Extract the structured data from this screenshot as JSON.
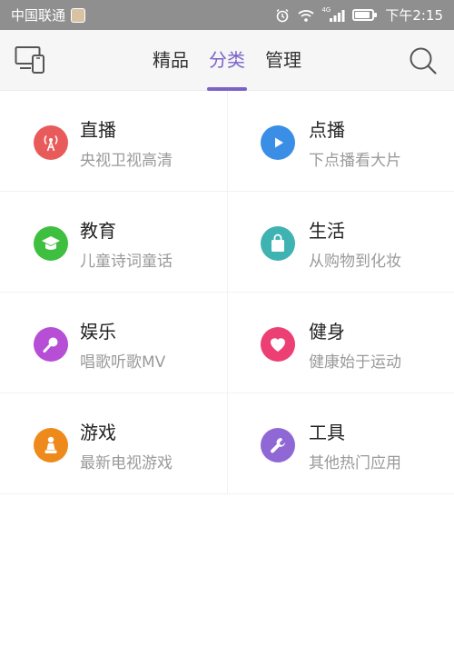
{
  "status_bar": {
    "carrier": "中国联通",
    "time": "下午2:15",
    "network_badge": "4G"
  },
  "nav": {
    "tabs": [
      {
        "label": "精品",
        "active": false
      },
      {
        "label": "分类",
        "active": true
      },
      {
        "label": "管理",
        "active": false
      }
    ],
    "accent_color": "#7b62c8"
  },
  "categories": [
    {
      "title": "直播",
      "subtitle": "央视卫视高清",
      "icon": "broadcast-tower-icon",
      "color": "#e95b5b"
    },
    {
      "title": "点播",
      "subtitle": "下点播看大片",
      "icon": "play-icon",
      "color": "#3a8ee6"
    },
    {
      "title": "教育",
      "subtitle": "儿童诗词童话",
      "icon": "graduation-cap-icon",
      "color": "#3fbf3f"
    },
    {
      "title": "生活",
      "subtitle": "从购物到化妆",
      "icon": "shopping-bag-icon",
      "color": "#3fb2b2"
    },
    {
      "title": "娱乐",
      "subtitle": "唱歌听歌MV",
      "icon": "microphone-icon",
      "color": "#b64fd6"
    },
    {
      "title": "健身",
      "subtitle": "健康始于运动",
      "icon": "heart-icon",
      "color": "#ec3f74"
    },
    {
      "title": "游戏",
      "subtitle": "最新电视游戏",
      "icon": "game-piece-icon",
      "color": "#ee8a1c"
    },
    {
      "title": "工具",
      "subtitle": "其他热门应用",
      "icon": "wrench-icon",
      "color": "#8f68d6"
    }
  ]
}
